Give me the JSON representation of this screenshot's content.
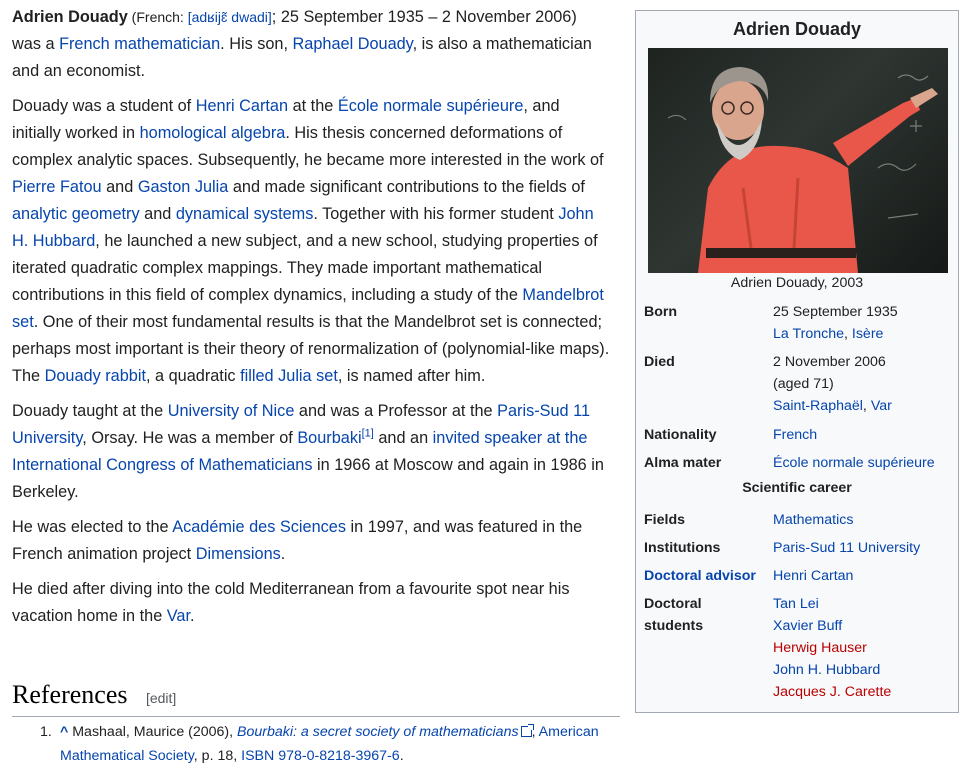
{
  "lead": {
    "name": "Adrien Douady",
    "paren_open": " (",
    "french_label": "French: ",
    "ipa": "[adʁijɛ̃ dwadi]",
    "after_ipa": "; 25 September 1935 – 2 November 2006)",
    "was_a": " was a ",
    "link_french_math": "French mathematician",
    "his_son": ". His son, ",
    "link_raphael": "Raphael Douady",
    "son_tail": ", is also a mathematician and an economist."
  },
  "p2": {
    "t1": "Douady was a student of ",
    "l_cartan": "Henri Cartan",
    "t2": " at the ",
    "l_ens": "École normale supérieure",
    "t3": ", and initially worked in ",
    "l_homalg": "homological algebra",
    "t4": ". His thesis concerned deformations of complex analytic spaces. Subsequently, he became more interested in the work of ",
    "l_fatou": "Pierre Fatou",
    "t5": " and ",
    "l_julia": "Gaston Julia",
    "t6": " and made significant contributions to the fields of ",
    "l_angeo": "analytic geometry",
    "t7": " and ",
    "l_dynsys": "dynamical systems",
    "t8": ". Together with his former student ",
    "l_hubbard": "John H. Hubbard",
    "t9": ", he launched a new subject, and a new school, studying properties of iterated quadratic complex mappings. They made important mathematical contributions in this field of complex dynamics, including a study of the ",
    "l_mandel": "Mandelbrot set",
    "t10": ". One of their most fundamental results is that the Mandelbrot set is connected; perhaps most important is their theory of renormalization of (polynomial-like maps). The ",
    "l_rabbit": "Douady rabbit",
    "t11": ", a quadratic ",
    "l_filled": "filled Julia set",
    "t12": ", is named after him."
  },
  "p3": {
    "t1": "Douady taught at the ",
    "l_nice": "University of Nice",
    "t2": " and was a Professor at the ",
    "l_paris": "Paris-Sud 11 University",
    "t3": ", Orsay. He was a member of ",
    "l_bourbaki": "Bourbaki",
    "ref": "[1]",
    "t4": " and an ",
    "l_icm": "invited speaker at the International Congress of Mathematicians",
    "t5": " in 1966 at Moscow and again in 1986 in Berkeley."
  },
  "p4": {
    "t1": "He was elected to the ",
    "l_acad": "Académie des Sciences",
    "t2": " in 1997, and was featured in the French animation project ",
    "l_dims": "Dimensions",
    "t3": "."
  },
  "p5": {
    "t1": "He died after diving into the cold Mediterranean from a favourite spot near his vacation home in the ",
    "l_var": "Var",
    "t2": "."
  },
  "references": {
    "heading": "References",
    "edit": "[edit]",
    "items": [
      {
        "num": "1.",
        "caret": "^",
        "author": " Mashaal, Maurice (2006), ",
        "title": "Bourbaki: a secret society of mathematicians",
        "sep": ", ",
        "publisher": "American Mathematical Society",
        "pages": ", p. 18, ",
        "isbn_label": "ISBN",
        "isbn": "978-0-8218-3967-6",
        "end": "."
      }
    ]
  },
  "infobox": {
    "title": "Adrien Douady",
    "caption": "Adrien Douady, 2003",
    "born_label": "Born",
    "born_date": "25 September 1935",
    "born_place_1": "La Tronche",
    "born_sep": ", ",
    "born_place_2": "Isère",
    "died_label": "Died",
    "died_date": "2 November 2006",
    "died_age": "(aged 71)",
    "died_place_1": "Saint-Raphaël",
    "died_sep": ", ",
    "died_place_2": "Var",
    "nationality_label": "Nationality",
    "nationality": "French",
    "alma_label": "Alma mater",
    "alma": "École normale supérieure",
    "career_heading": "Scientific career",
    "fields_label": "Fields",
    "fields": "Mathematics",
    "institutions_label": "Institutions",
    "institutions": "Paris-Sud 11 University",
    "advisor_label": "Doctoral advisor",
    "advisor": "Henri Cartan",
    "students_label_1": "Doctoral",
    "students_label_2": "students",
    "students": [
      {
        "name": "Tan Lei",
        "exists": true
      },
      {
        "name": "Xavier Buff",
        "exists": true
      },
      {
        "name": "Herwig Hauser",
        "exists": false
      },
      {
        "name": "John H. Hubbard",
        "exists": true
      },
      {
        "name": "Jacques J. Carette",
        "exists": false
      }
    ]
  },
  "colors": {
    "link": "#0645ad",
    "redlink": "#ba0000",
    "text": "#202122",
    "infobox_bg": "#f8f9fa",
    "border": "#a2a9b1",
    "shirt": "#e8574a"
  }
}
